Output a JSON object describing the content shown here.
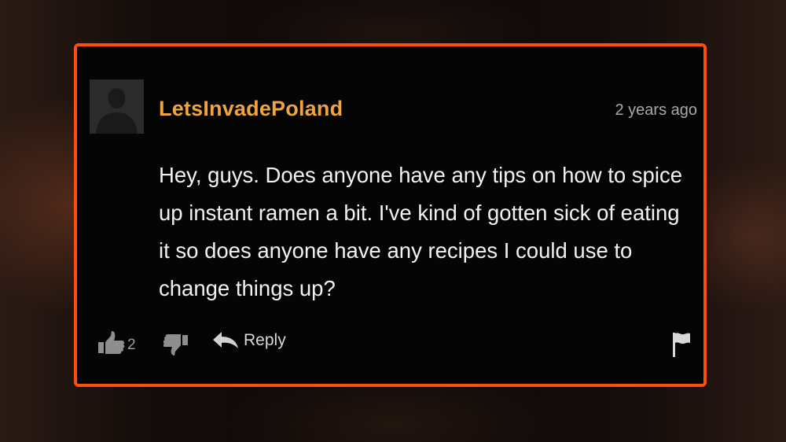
{
  "comment": {
    "username": "LetsInvadePoland",
    "timestamp": "2 years ago",
    "text": "Hey, guys. Does anyone have any tips on how to spice up instant ramen a bit. I've kind of gotten sick of eating it so does anyone have any recipes I could use to change things up?",
    "avatar_icon": "default-user-silhouette-icon"
  },
  "actions": {
    "like_icon": "thumbs-up-icon",
    "like_count": "2",
    "dislike_icon": "thumbs-down-icon",
    "reply_icon": "reply-arrow-icon",
    "reply_label": "Reply",
    "flag_icon": "flag-icon"
  },
  "colors": {
    "border": "#ff4d0f",
    "username": "#f0a53c",
    "text": "#f2f2f2",
    "timestamp": "#a9a9a9"
  }
}
